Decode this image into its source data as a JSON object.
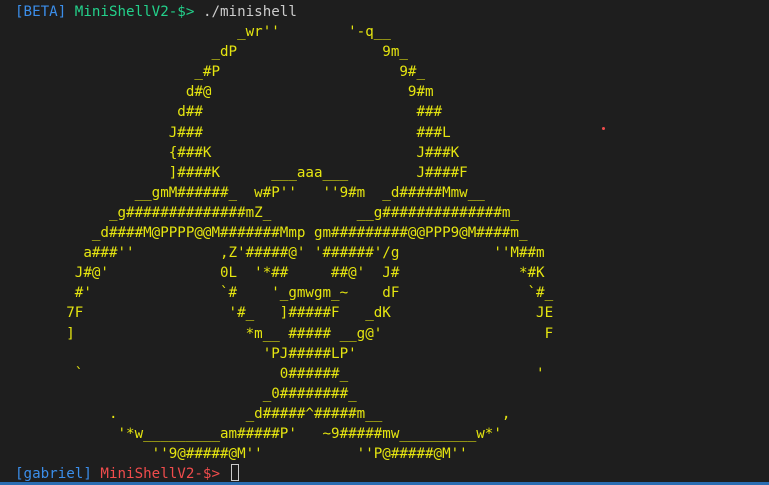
{
  "first_prompt": {
    "tag": "[BETA]",
    "shell": "MiniShellV2-$>",
    "command": "./minishell"
  },
  "ascii_art": "                          _wr''        '-q__\n                       _dP                 9m_\n                     _#P                     9#_\n                    d#@                       9#m\n                   d##                         ###\n                  J###                         ###L\n                  {###K                        J###K\n                  ]####K      ___aaa___        J####F\n              __gmM######_  w#P''   ''9#m  _d#####Mmw__\n           _g##############mZ_          __g##############m_\n         _d####M@PPPP@@M#######Mmp gm#########@@PPP9@M####m_\n        a###''          ,Z'#####@' '######'/g           ''M##m\n       J#@'             0L  '*##     ##@'  J#              *#K\n       #'               `#    '_gmwgm_~    dF               `#_\n      7F                 '#_   ]#####F   _dK                 JE\n      ]                    *m__ ##### __g@'                   F\n                             'PJ#####LP'\n       `                       0######_                      '\n                             _0########_\n           .               _d#####^#####m__              ,\n            '*w_________am#####P'   ~9#####mw_________w*'\n                ''9@#####@M''           ''P@#####@M''",
  "second_prompt": {
    "user": "[gabriel]",
    "shell": "MiniShellV2-$>"
  },
  "colors": {
    "background": "#1e1e1e",
    "art": "#e5e510",
    "blue": "#3b8eea",
    "green": "#23d18b",
    "red": "#f14c4c"
  }
}
